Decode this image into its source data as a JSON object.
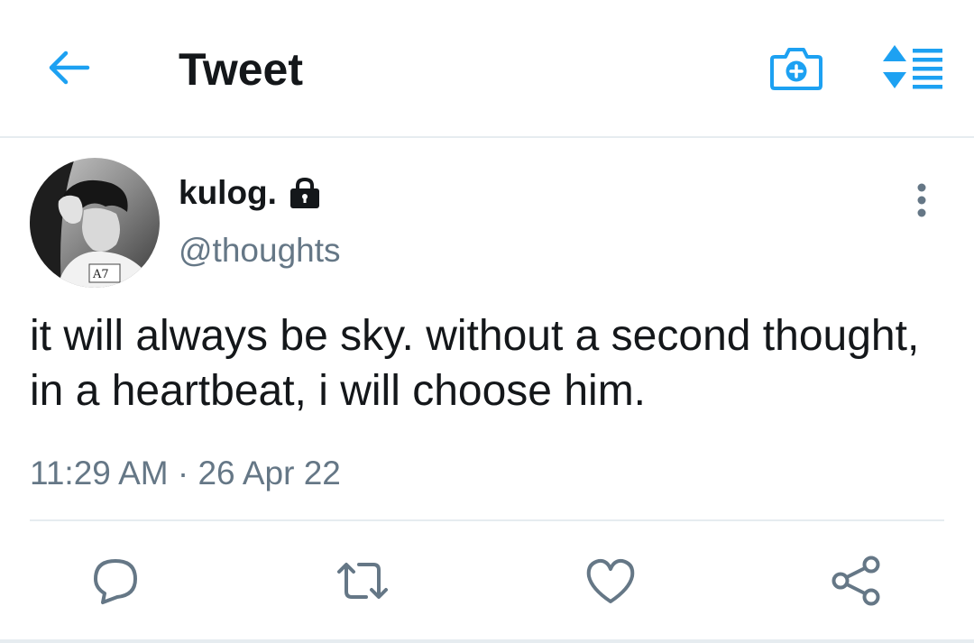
{
  "header": {
    "back_icon": "arrow-left-icon",
    "title": "Tweet",
    "camera_icon": "camera-plus-icon",
    "sort_icon": "sort-list-icon",
    "accent_color": "#1da1f2"
  },
  "tweet": {
    "avatar_alt": "profile-photo",
    "display_name": "kulog.",
    "protected_icon": "lock-icon",
    "handle": "@thoughts",
    "more_icon": "more-vertical-icon",
    "text": "it will always be sky. without a second thought, in a heartbeat, i will choose him.",
    "timestamp": "11:29 AM · 26 Apr 22"
  },
  "actions": [
    {
      "name": "reply",
      "icon": "reply-icon"
    },
    {
      "name": "retweet",
      "icon": "retweet-icon"
    },
    {
      "name": "like",
      "icon": "heart-icon"
    },
    {
      "name": "share",
      "icon": "share-icon"
    }
  ],
  "colors": {
    "text_primary": "#14171a",
    "text_secondary": "#657786",
    "divider": "#e6ecf0",
    "accent": "#1da1f2"
  }
}
